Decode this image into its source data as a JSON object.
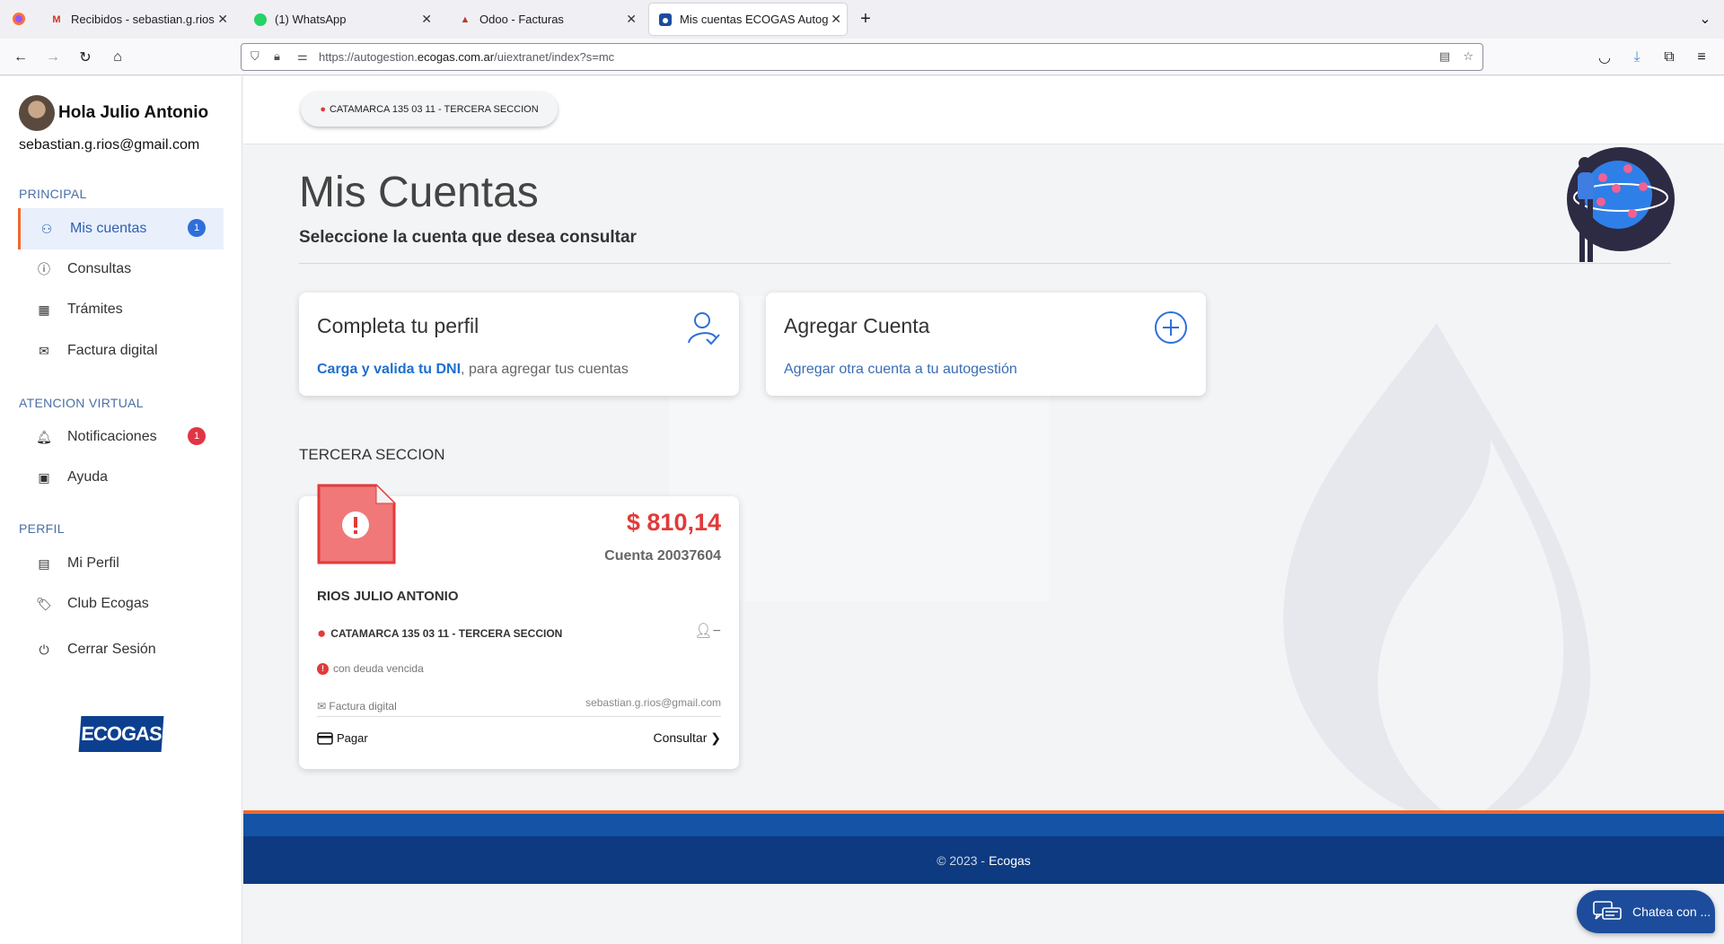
{
  "browser": {
    "tabs": [
      {
        "title": "Recibidos - sebastian.g.rios",
        "icon": "gmail-icon"
      },
      {
        "title": "(1) WhatsApp",
        "icon": "whatsapp-icon"
      },
      {
        "title": "Odoo - Facturas",
        "icon": "odoo-icon"
      },
      {
        "title": "Mis cuentas ECOGAS Autog",
        "icon": "ecogas-icon"
      }
    ],
    "url_prefix": "https://autogestion.",
    "url_domain": "ecogas.com.ar",
    "url_path": "/uiextranet/index?s=mc"
  },
  "sidebar": {
    "greeting": "Hola Julio Antonio",
    "email": "sebastian.g.rios@gmail.com",
    "sections": {
      "principal": "PRINCIPAL",
      "atencion": "ATENCION VIRTUAL",
      "perfil": "PERFIL"
    },
    "items": {
      "mis_cuentas": {
        "label": "Mis cuentas",
        "badge": "1"
      },
      "consultas": {
        "label": "Consultas"
      },
      "tramites": {
        "label": "Trámites"
      },
      "factura_digital": {
        "label": "Factura digital"
      },
      "notificaciones": {
        "label": "Notificaciones",
        "badge": "1"
      },
      "ayuda": {
        "label": "Ayuda"
      },
      "mi_perfil": {
        "label": "Mi Perfil"
      },
      "club_ecogas": {
        "label": "Club Ecogas"
      },
      "cerrar_sesion": {
        "label": "Cerrar Sesión"
      }
    },
    "logo_text": "ECOGAS"
  },
  "header": {
    "address_pill": "CATAMARCA 135 03 11 - TERCERA SECCION"
  },
  "main": {
    "title": "Mis Cuentas",
    "subtitle": "Seleccione la cuenta que desea consultar",
    "profile_card": {
      "title": "Completa tu perfil",
      "link": "Carga y valida tu DNI",
      "text": ", para agregar tus cuentas"
    },
    "add_card": {
      "title": "Agregar Cuenta",
      "text": "Agregar otra cuenta a tu autogestión"
    },
    "zone_title": "TERCERA SECCION",
    "account": {
      "amount": "$ 810,14",
      "number": "Cuenta 20037604",
      "holder": "RIOS JULIO ANTONIO",
      "address": "CATAMARCA 135 03 11 - TERCERA SECCION",
      "status": "con deuda vencida",
      "factura_label": "Factura digital",
      "factura_email": "sebastian.g.rios@gmail.com",
      "pay_label": "Pagar",
      "consult_label": "Consultar"
    }
  },
  "footer": {
    "copyright": "© 2023 -",
    "brand": "Ecogas"
  },
  "chat": {
    "label": "Chatea con ..."
  },
  "colors": {
    "accent_orange": "#f0692b",
    "primary_blue": "#1453a6",
    "alert_red": "#e23a3a"
  }
}
